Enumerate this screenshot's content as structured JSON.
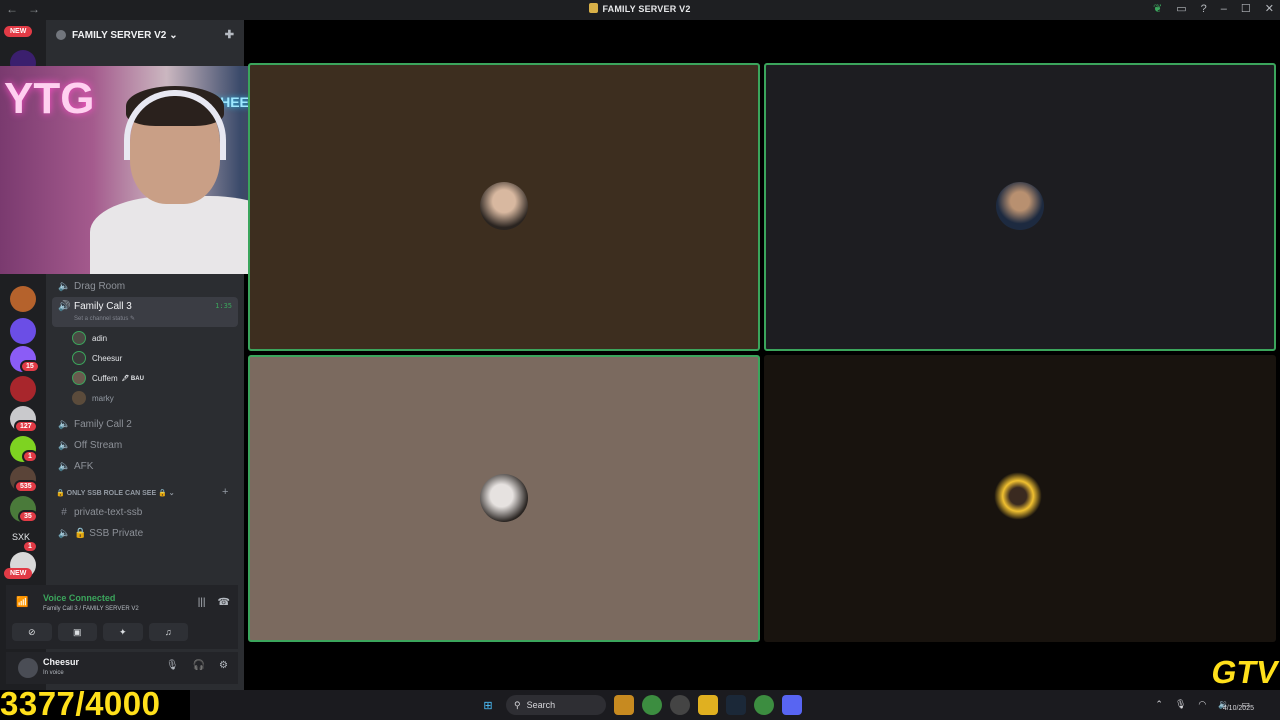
{
  "window": {
    "title": "FAMILY SERVER V2",
    "nav_back": "←",
    "nav_forward": "→",
    "icons": [
      "leaf-icon",
      "inbox-icon",
      "help-icon",
      "minimize-icon",
      "maximize-icon",
      "close-icon"
    ],
    "glyphs": {
      "leaf": "❦",
      "inbox": "▭",
      "help": "?",
      "minimize": "–",
      "maximize": "☐",
      "close": "✕"
    }
  },
  "rail": {
    "new_top": "NEW",
    "new_bottom": "NEW",
    "badges": [
      "15",
      "127",
      "1",
      "535",
      "35",
      "1"
    ],
    "sxk_label": "SXK"
  },
  "sidebar": {
    "server_name": "FAMILY SERVER V2",
    "chevron": "⌄",
    "channels": {
      "drag_room": "Drag Room",
      "family_call_3": "Family Call 3",
      "family_call_3_timer": "1:35",
      "family_call_3_status": "Set a channel status ✎",
      "family_call_2": "Family Call 2",
      "off_stream": "Off Stream",
      "afk": "AFK",
      "private_text": "private-text-ssb",
      "ssb_private": "🔒 SSB Private"
    },
    "members": [
      {
        "name": "adin"
      },
      {
        "name": "Cheesur"
      },
      {
        "name": "Cuffem",
        "tag": "🖊 BAU"
      },
      {
        "name": "marky"
      }
    ],
    "category": "🔒 ONLY SSB ROLE CAN SEE 🔒 ⌄",
    "category_add": "+"
  },
  "voice": {
    "status": "Voice Connected",
    "location": "Family Call 3 / FAMILY SERVER V2",
    "buttons": [
      "video-off",
      "screen-share",
      "activities",
      "soundboard"
    ]
  },
  "user": {
    "name": "Cheesur",
    "status": "In voice"
  },
  "webcam": {
    "sign_left": "YTG",
    "sign_right": "CHEESUR"
  },
  "counter": "3377/4000",
  "taskbar": {
    "search_placeholder": "Search",
    "date": "4/10/2025"
  },
  "overlay_logo": "GTV",
  "colors": {
    "speaking": "#3ba55c",
    "counter": "#ffe01b",
    "badge": "#e23b46"
  }
}
